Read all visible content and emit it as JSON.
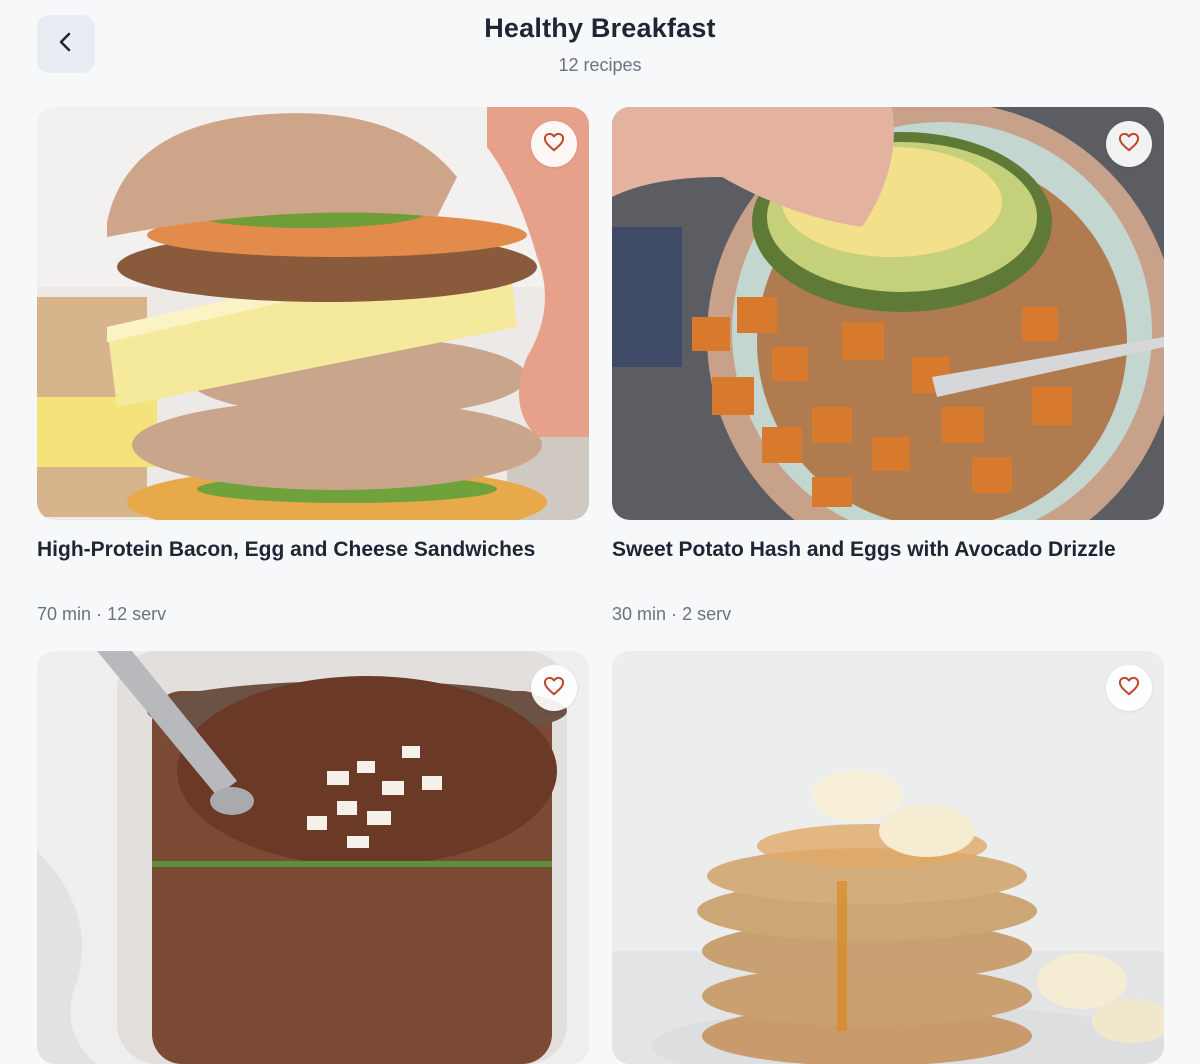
{
  "header": {
    "title": "Healthy Breakfast",
    "subtitle": "12 recipes",
    "back_icon": "chevron-left-icon"
  },
  "colors": {
    "accent": "#c0462a",
    "background": "#f7f8fa",
    "back_button_bg": "#e9edf3"
  },
  "recipes": [
    {
      "title": "High-Protein Bacon, Egg and Cheese Sandwiches",
      "time": "70 min",
      "separator": "·",
      "servings": "12 serv",
      "favorite_icon": "heart-outline-icon"
    },
    {
      "title": "Sweet Potato Hash and Eggs with Avocado Drizzle",
      "time": "30 min",
      "separator": "·",
      "servings": "2 serv",
      "favorite_icon": "heart-outline-icon"
    },
    {
      "title": "",
      "time": "",
      "separator": "",
      "servings": "",
      "favorite_icon": "heart-outline-icon"
    },
    {
      "title": "",
      "time": "",
      "separator": "",
      "servings": "",
      "favorite_icon": "heart-outline-icon"
    }
  ]
}
